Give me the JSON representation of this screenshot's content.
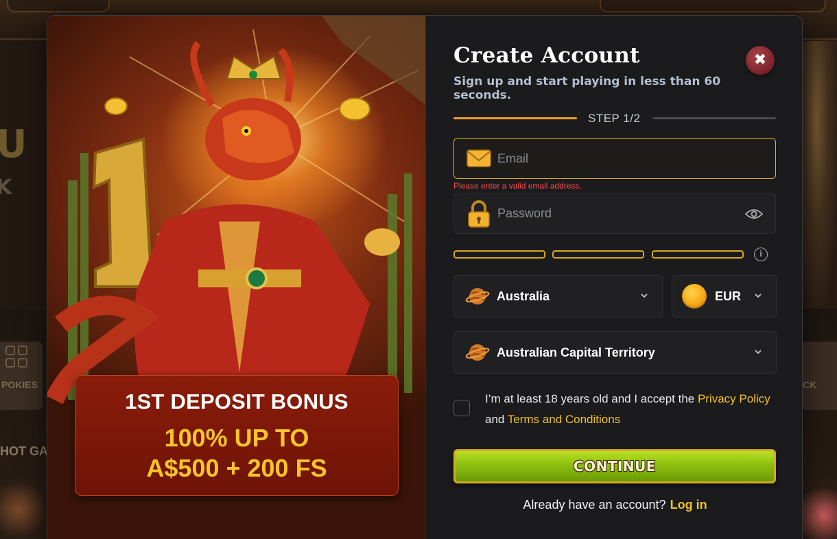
{
  "backdrop": {
    "left_label_cut": "POKIES",
    "left_hot_cut": "HOT GA",
    "right_label_cut": "CK"
  },
  "promo": {
    "title": "1ST DEPOSIT BONUS",
    "line1": "100% UP TO",
    "line2": "A$500 + 200 FS"
  },
  "form": {
    "title": "Create Account",
    "subtitle": "Sign up and start playing in less than 60 seconds.",
    "close_icon": "✖",
    "step_label": "STEP  1/2",
    "email": {
      "placeholder": "Email",
      "icon": "envelope-icon",
      "error": "Please enter a valid email address."
    },
    "password": {
      "placeholder": "Password",
      "icon": "lock-icon",
      "toggle_icon": "eye-icon"
    },
    "strength_info_icon": "i",
    "country": {
      "value": "Australia",
      "icon": "planet-icon"
    },
    "currency": {
      "value": "EUR",
      "icon": "coin-icon"
    },
    "region": {
      "value": "Australian Capital Territory",
      "icon": "planet-icon"
    },
    "terms": {
      "prefix": "I’m at least 18 years old and I accept the ",
      "privacy": "Privacy Policy",
      "and": " and ",
      "tos": "Terms and Conditions"
    },
    "continue_label": "CONTINUE",
    "login_prompt": "Already have an account?",
    "login_link": "Log in"
  },
  "colors": {
    "accent_gold": "#f2c22a",
    "error_red": "#ff4a4a",
    "continue_green": "#8cc00e"
  }
}
